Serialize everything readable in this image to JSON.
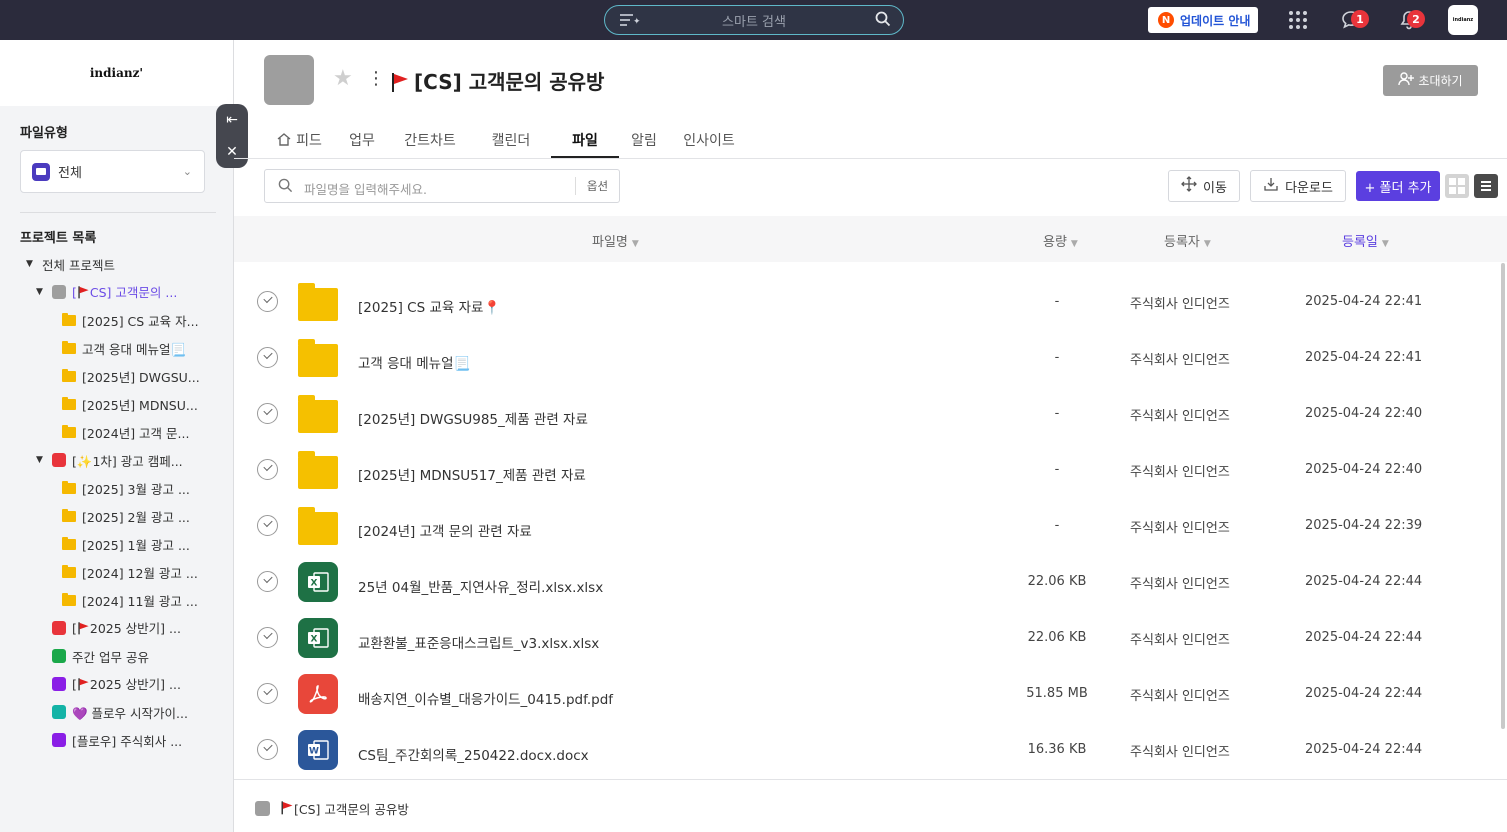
{
  "topbar": {
    "search_placeholder": "스마트 검색",
    "update_label": "업데이트 안내",
    "update_badge": "N",
    "chat_badge": "1",
    "notif_badge": "2",
    "avatar_text": "indianz"
  },
  "sidebar": {
    "logo": "indianz'",
    "filetype_heading": "파일유형",
    "filetype_value": "전체",
    "project_heading": "프로젝트 목록",
    "tree": [
      {
        "label": "전체 프로젝트",
        "level": 0,
        "kind": "root"
      },
      {
        "label": "[CS] 고객문의 ...",
        "level": 1,
        "kind": "project",
        "color": "#9e9e9e",
        "flag": true,
        "active": true
      },
      {
        "label": "[2025] CS 교육 자...",
        "level": 2,
        "kind": "folder"
      },
      {
        "label": "고객 응대 메뉴얼📃",
        "level": 2,
        "kind": "folder"
      },
      {
        "label": "[2025년] DWGSU...",
        "level": 2,
        "kind": "folder"
      },
      {
        "label": "[2025년] MDNSU...",
        "level": 2,
        "kind": "folder"
      },
      {
        "label": "[2024년] 고객 문...",
        "level": 2,
        "kind": "folder"
      },
      {
        "label": "[✨1차] 광고 캠페...",
        "level": 1,
        "kind": "project",
        "color": "#e8343b"
      },
      {
        "label": "[2025] 3월 광고 ...",
        "level": 2,
        "kind": "folder"
      },
      {
        "label": "[2025] 2월 광고 ...",
        "level": 2,
        "kind": "folder"
      },
      {
        "label": "[2025] 1월 광고 ...",
        "level": 2,
        "kind": "folder"
      },
      {
        "label": "[2024] 12월 광고 ...",
        "level": 2,
        "kind": "folder"
      },
      {
        "label": "[2024] 11월 광고 ...",
        "level": 2,
        "kind": "folder"
      },
      {
        "label": "[2025 상반기] ...",
        "level": 1,
        "kind": "leaf",
        "color": "#e8343b",
        "flag": true
      },
      {
        "label": "주간 업무 공유",
        "level": 1,
        "kind": "leaf",
        "color": "#1aa84a"
      },
      {
        "label": "[2025 상반기] ...",
        "level": 1,
        "kind": "leaf",
        "color": "#8a1ee6",
        "flag": true
      },
      {
        "label": "💜 플로우 시작가이...",
        "level": 1,
        "kind": "leaf",
        "color": "#13b3a6"
      },
      {
        "label": "[플로우] 주식회사 ...",
        "level": 1,
        "kind": "leaf",
        "color": "#8a1ee6"
      }
    ]
  },
  "header": {
    "title": "[CS] 고객문의 공유방",
    "invite_label": "초대하기",
    "tabs": [
      "피드",
      "업무",
      "간트차트",
      "캘린더",
      "파일",
      "알림",
      "인사이트"
    ],
    "active_tab": "파일"
  },
  "toolbar": {
    "search_placeholder": "파일명을 입력해주세요.",
    "options_label": "옵션",
    "move_label": "이동",
    "download_label": "다운로드",
    "add_folder_label": "+ 폴더 추가"
  },
  "table": {
    "columns": [
      "파일명",
      "용량",
      "등록자",
      "등록일"
    ],
    "sorted_column": "등록일",
    "rows": [
      {
        "type": "folder",
        "name": "[2025] CS 교육 자료📍",
        "size": "-",
        "owner": "주식회사 인디언즈",
        "date": "2025-04-24 22:41"
      },
      {
        "type": "folder",
        "name": "고객 응대 메뉴얼📃",
        "size": "-",
        "owner": "주식회사 인디언즈",
        "date": "2025-04-24 22:41"
      },
      {
        "type": "folder",
        "name": "[2025년] DWGSU985_제품 관련 자료",
        "size": "-",
        "owner": "주식회사 인디언즈",
        "date": "2025-04-24 22:40"
      },
      {
        "type": "folder",
        "name": "[2025년] MDNSU517_제품 관련 자료",
        "size": "-",
        "owner": "주식회사 인디언즈",
        "date": "2025-04-24 22:40"
      },
      {
        "type": "folder",
        "name": "[2024년] 고객 문의 관련 자료",
        "size": "-",
        "owner": "주식회사 인디언즈",
        "date": "2025-04-24 22:39"
      },
      {
        "type": "xlsx",
        "name": "25년 04월_반품_지연사유_정리.xlsx.xlsx",
        "size": "22.06 KB",
        "owner": "주식회사 인디언즈",
        "date": "2025-04-24 22:44"
      },
      {
        "type": "xlsx",
        "name": "교환환불_표준응대스크립트_v3.xlsx.xlsx",
        "size": "22.06 KB",
        "owner": "주식회사 인디언즈",
        "date": "2025-04-24 22:44"
      },
      {
        "type": "pdf",
        "name": "배송지연_이슈별_대응가이드_0415.pdf.pdf",
        "size": "51.85 MB",
        "owner": "주식회사 인디언즈",
        "date": "2025-04-24 22:44"
      },
      {
        "type": "docx",
        "name": "CS팀_주간회의록_250422.docx.docx",
        "size": "16.36 KB",
        "owner": "주식회사 인디언즈",
        "date": "2025-04-24 22:44"
      }
    ]
  },
  "footer": {
    "breadcrumb": "[CS] 고객문의 공유방"
  },
  "colors": {
    "accent": "#5b3fe0",
    "xlsx": "#1e7145",
    "pdf": "#e8473a",
    "docx": "#2b579a",
    "folder": "#f5c000"
  }
}
